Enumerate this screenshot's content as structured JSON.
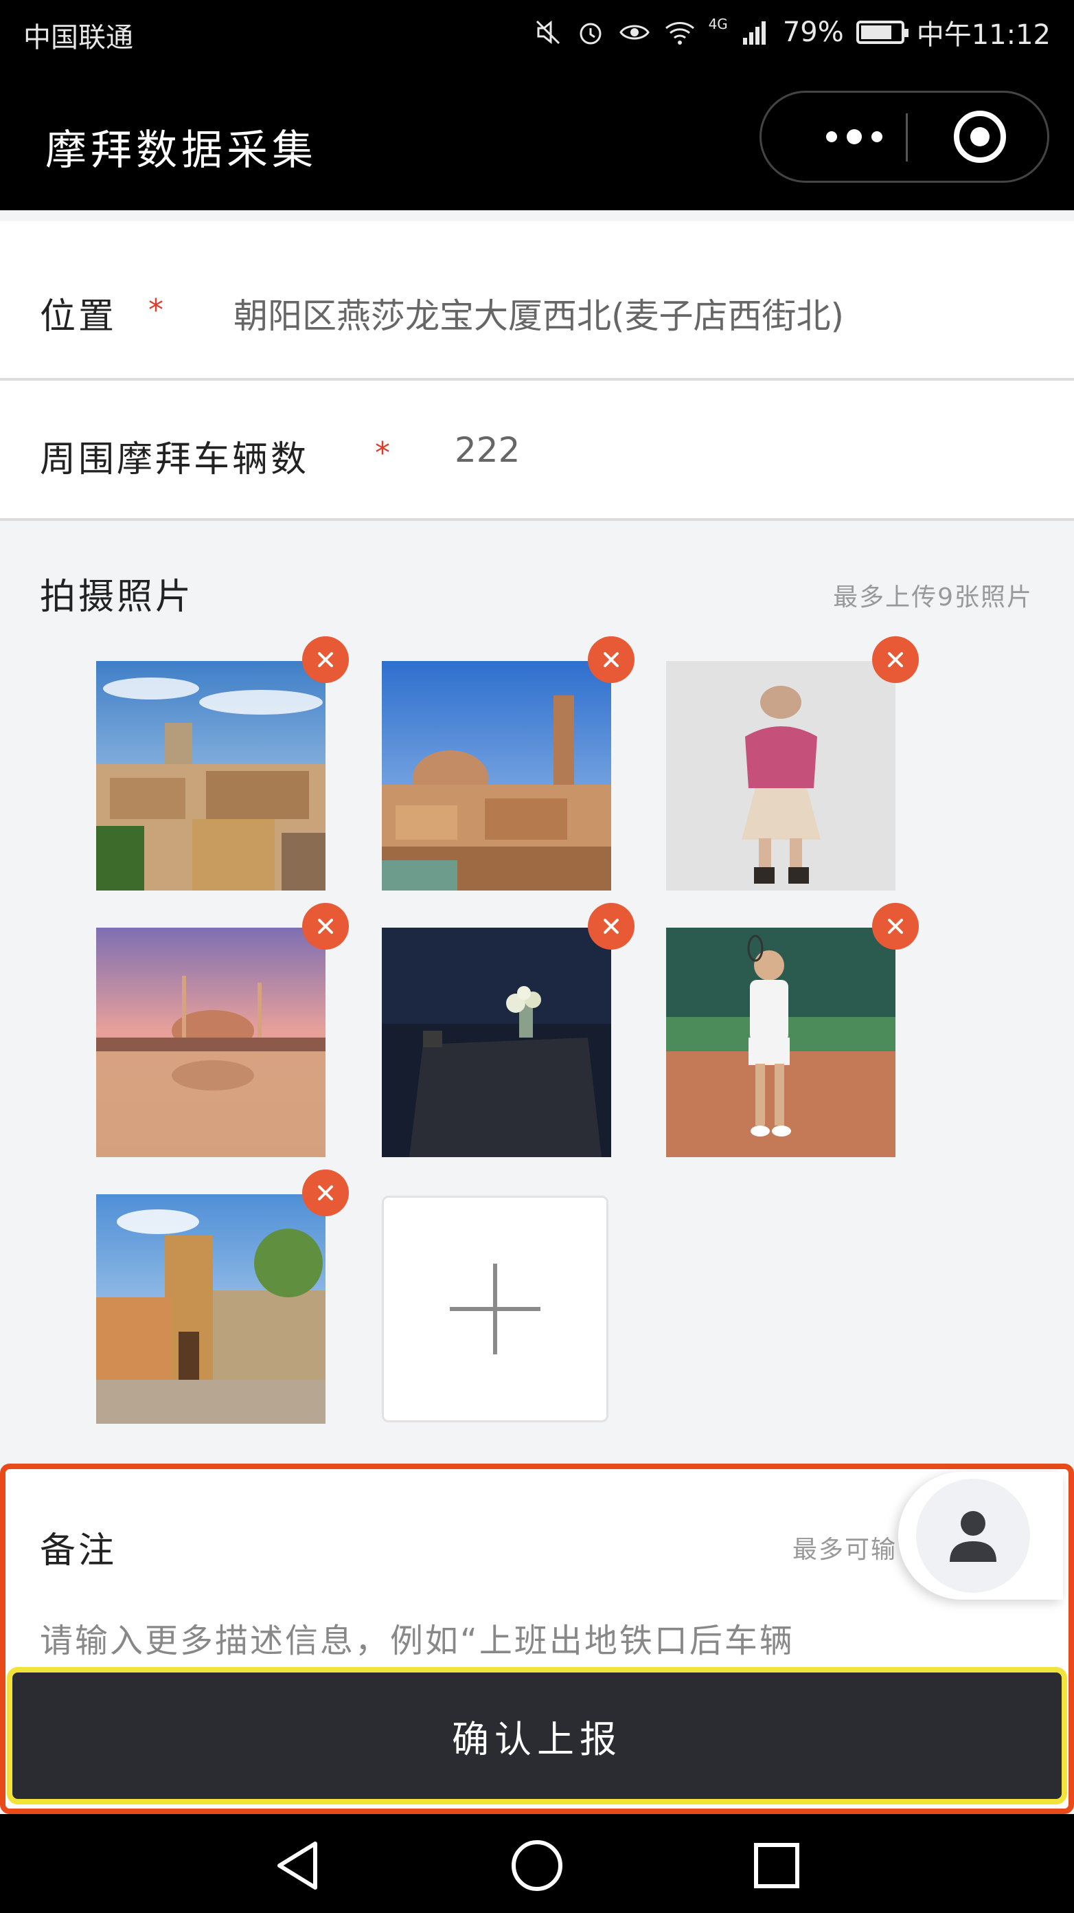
{
  "status_bar": {
    "carrier": "中国联通",
    "network": "4G",
    "battery": "79%",
    "battery_level": 0.79,
    "time": "中午11:12",
    "icons": [
      "mute-icon",
      "alarm-icon",
      "eye-icon",
      "wifi-icon",
      "signal-icon",
      "battery-icon"
    ]
  },
  "navbar": {
    "title": "摩拜数据采集",
    "icons": [
      "more-icon",
      "close-target-icon"
    ]
  },
  "form": {
    "location": {
      "label": "位置",
      "required_mark": "*",
      "value": "朝阳区燕莎龙宝大厦西北(麦子店西街北)"
    },
    "bike_count": {
      "label": "周围摩拜车辆数",
      "required_mark": "*",
      "value": "222"
    }
  },
  "photos": {
    "title": "拍摄照片",
    "hint": "最多上传9张照片",
    "items": [
      {
        "subject": "hilltop town with tower",
        "delete_icon": "close-icon"
      },
      {
        "subject": "city skyline with dome and tower",
        "delete_icon": "close-icon"
      },
      {
        "subject": "woman in pink sweater and hat",
        "delete_icon": "close-icon"
      },
      {
        "subject": "mosque at sunset by the water",
        "delete_icon": "close-icon"
      },
      {
        "subject": "still life table with flowers",
        "delete_icon": "close-icon"
      },
      {
        "subject": "tennis player on clay court",
        "delete_icon": "close-icon"
      },
      {
        "subject": "medieval tower and old street",
        "delete_icon": "close-icon"
      }
    ],
    "add_icon": "plus-icon"
  },
  "notes": {
    "title": "备注",
    "hint": "最多可输",
    "placeholder": "请输入更多描述信息，例如“上班出地铁口后车辆"
  },
  "confirm_button": "确认上报",
  "fab_icon": "user-icon",
  "android_nav": {
    "icons": [
      "back-icon",
      "home-icon",
      "recents-icon"
    ]
  },
  "colors": {
    "accent_red": "#e85a35",
    "required_red": "#e03a2b",
    "button_bg": "#2b2c31",
    "highlight_orange": "#e84a1a",
    "highlight_yellow": "#f2e23a"
  }
}
